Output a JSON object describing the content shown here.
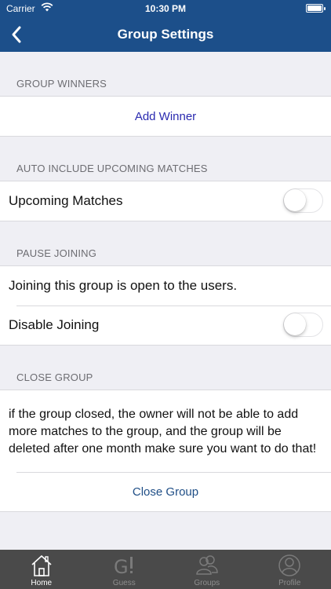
{
  "status_bar": {
    "carrier": "Carrier",
    "time": "10:30 PM"
  },
  "nav": {
    "title": "Group Settings",
    "back_icon": "chevron-left-icon"
  },
  "sections": {
    "winners": {
      "header": "GROUP WINNERS",
      "add_winner_label": "Add Winner"
    },
    "auto_include": {
      "header": "AUTO INCLUDE UPCOMING MATCHES",
      "toggle_label": "Upcoming Matches",
      "toggle_on": false
    },
    "pause_joining": {
      "header": "PAUSE JOINING",
      "info_text": "Joining this group is open to the users.",
      "toggle_label": "Disable Joining",
      "toggle_on": false
    },
    "close_group": {
      "header": "CLOSE GROUP",
      "warning_text": "if the group closed, the owner will not be able to add more matches to the group, and the group will be deleted after one month make sure you want to do that!",
      "close_label": "Close Group"
    }
  },
  "tabbar": {
    "active": "home",
    "tabs": [
      {
        "id": "home",
        "label": "Home",
        "icon": "home-icon"
      },
      {
        "id": "guess",
        "label": "Guess",
        "icon": "guess-icon"
      },
      {
        "id": "groups",
        "label": "Groups",
        "icon": "groups-icon"
      },
      {
        "id": "profile",
        "label": "Profile",
        "icon": "profile-icon"
      }
    ]
  },
  "colors": {
    "nav_background": "#1c4f8a",
    "page_background": "#efeff4",
    "tabbar_background": "#4a4a4a",
    "add_winner_link": "#2a2ab0",
    "close_group_link": "#1f4e86"
  }
}
